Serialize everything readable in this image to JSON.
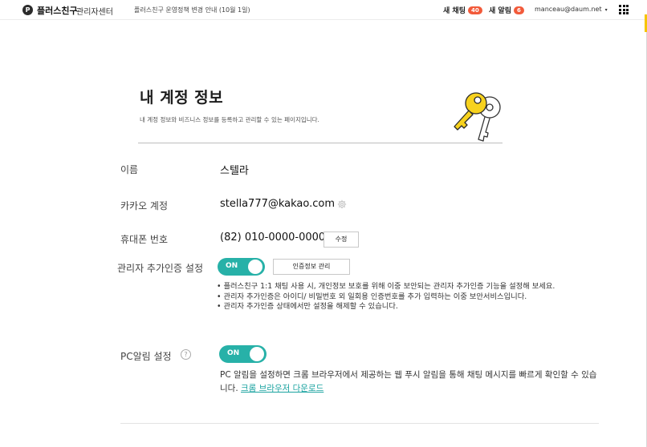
{
  "topbar": {
    "logo_letter": "P",
    "brand": "플러스친구",
    "brand_sub": "관리자센터",
    "notice": "플러스친구 운영정책 변경 안내 (10월 1일)",
    "chat_label": "새 채팅",
    "chat_count": "40",
    "alert_label": "새 알림",
    "alert_count": "6",
    "account": "manceau@daum.net",
    "account_caret": "▾",
    "accent_color": "#f6c500",
    "badge_color": "#f25a3a",
    "apps_icon": "grid-icon"
  },
  "header": {
    "title": "내 계정 정보",
    "subtitle": "내 계정 정보와 비즈니스 정보를 등록하고 관리할 수 있는 페이지입니다.",
    "illustration": "key-icon"
  },
  "form": {
    "name_label": "이름",
    "name_value": "스텔라",
    "kakao_label": "카카오 계정",
    "kakao_value": "stella777@kakao.com",
    "kakao_icon": "gear-icon",
    "phone_label": "휴대폰 번호",
    "phone_value": "(82) 010-0000-0000",
    "phone_edit": "수정",
    "twofactor_label": "관리자 추가인증 설정",
    "twofactor_toggle": "ON",
    "twofactor_manage": "인증정보 관리",
    "twofactor_bullets": [
      "• 플러스친구 1:1 채팅 사용 시, 개인정보 보호를 위해 이중 보안되는 관리자 추가인증 기능을 설정해 보세요.",
      "• 관리자 추가인증은 아이디/ 비밀번호 외 일회용 인증번호를 추가 입력하는 이중 보안서비스입니다.",
      "• 관리자 추가인증 상태에서만 설정을 해제할 수 있습니다."
    ],
    "pc_label": "PC알림 설정",
    "pc_help": "?",
    "pc_toggle": "ON",
    "pc_desc": "PC 알림을 설정하면 크롬 브라우저에서 제공하는 웹 푸시 알림을 통해 채팅 메시지를 빠르게 확인할 수 있습니다.",
    "pc_link": "크롬 브라우저 다운로드",
    "toggle_color": "#27b1a8",
    "link_color": "#1aa3a0"
  }
}
